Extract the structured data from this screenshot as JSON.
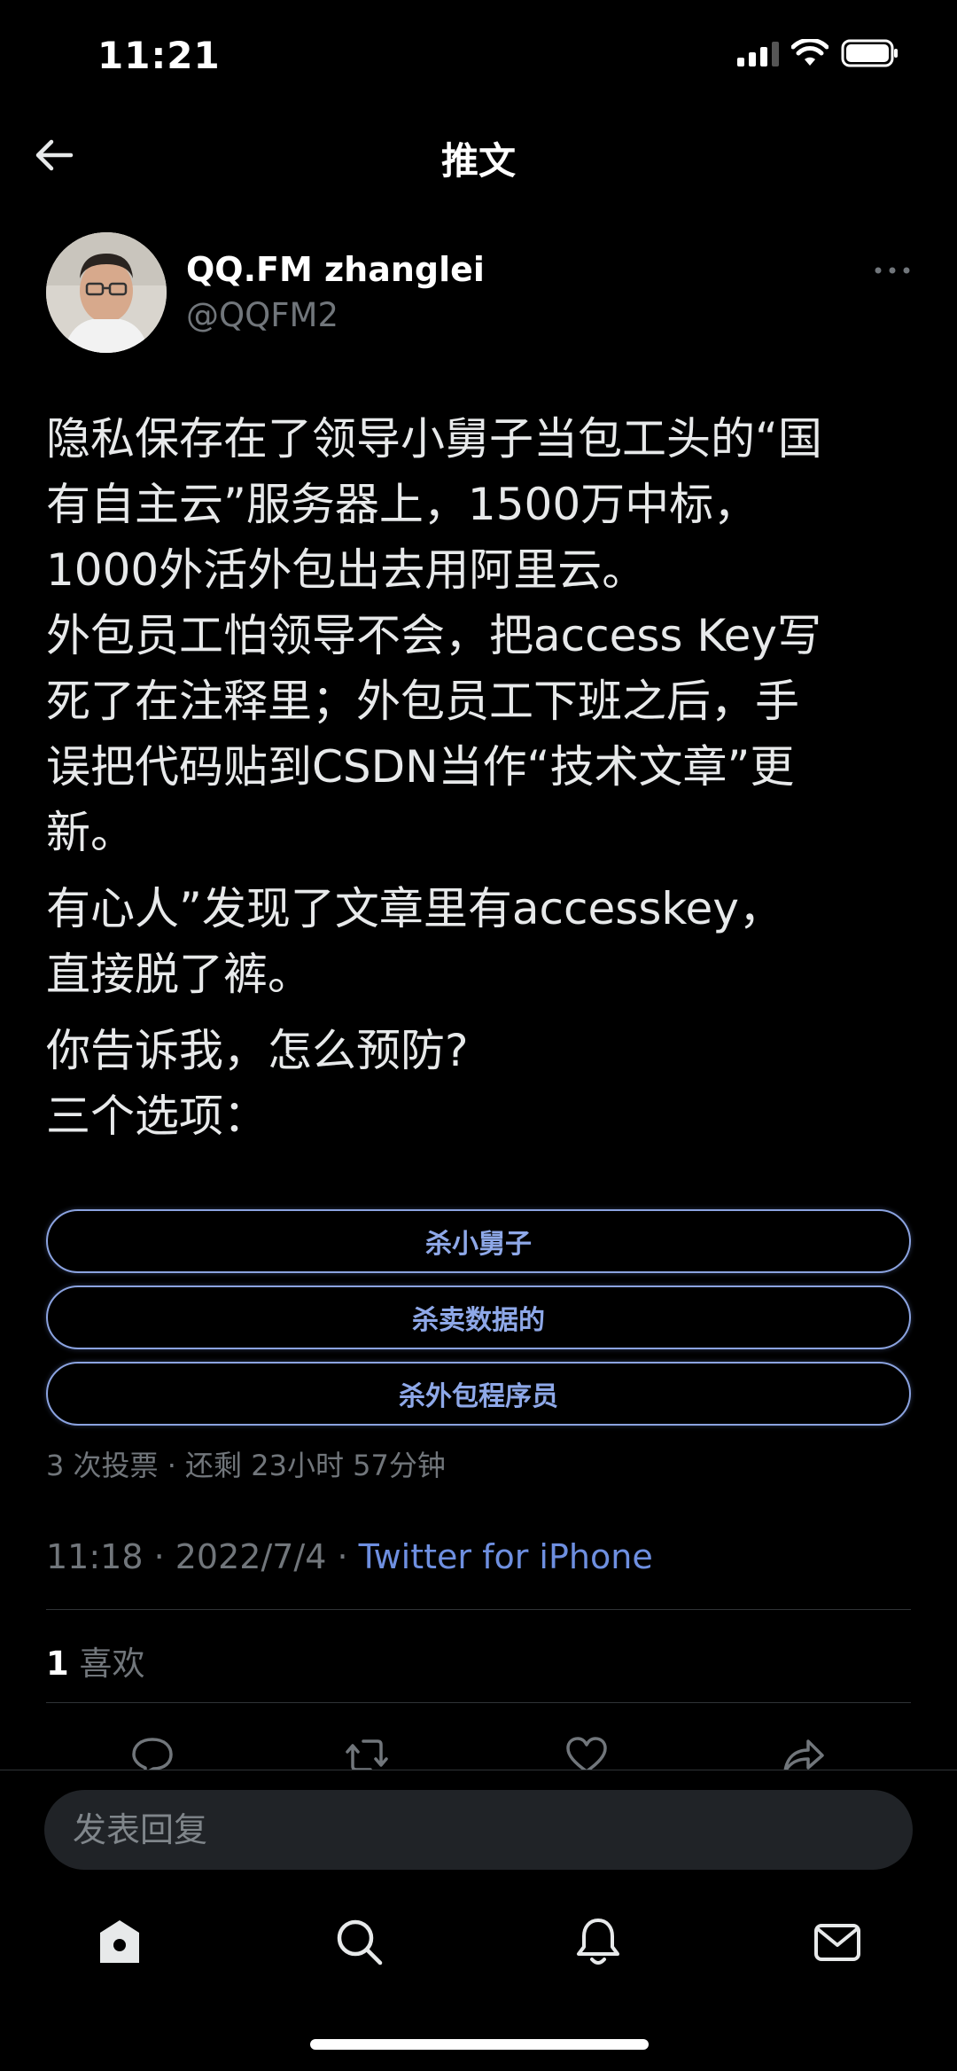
{
  "status_bar": {
    "time": "11:21"
  },
  "header": {
    "title": "推文"
  },
  "tweet": {
    "author_name": "QQ.FM zhanglei",
    "author_handle": "@QQFM2",
    "paragraphs": [
      [
        "隐私保存在了领导小舅子当包工头的“国",
        "有自主云”服务器上，1500万中标，",
        "1000外活外包出去用阿里云。",
        "外包员工怕领导不会，把access Key写",
        "死了在注释里；外包员工下班之后，手",
        "误把代码贴到CSDN当作“技术文章”更",
        "新。"
      ],
      [
        "有心人”发现了文章里有accesskey，",
        "直接脱了裤。"
      ],
      [
        "你告诉我，怎么预防?",
        "三个选项："
      ]
    ],
    "poll": {
      "options": [
        "杀小舅子",
        "杀卖数据的",
        "杀外包程序员"
      ],
      "meta": "3 次投票 · 还剩 23小时 57分钟"
    },
    "timestamp": "11:18 · 2022/7/4 · ",
    "source": "Twitter for iPhone",
    "likes_count": "1",
    "likes_label": " 喜欢"
  },
  "reply": {
    "placeholder": "发表回复"
  },
  "colors": {
    "background": "#000000",
    "accent": "#8ea8e8",
    "muted": "#71767b"
  },
  "icons": [
    "back-arrow-icon",
    "more-icon",
    "reply-icon",
    "retweet-icon",
    "like-icon",
    "share-icon",
    "home-icon",
    "search-icon",
    "notifications-icon",
    "messages-icon"
  ]
}
